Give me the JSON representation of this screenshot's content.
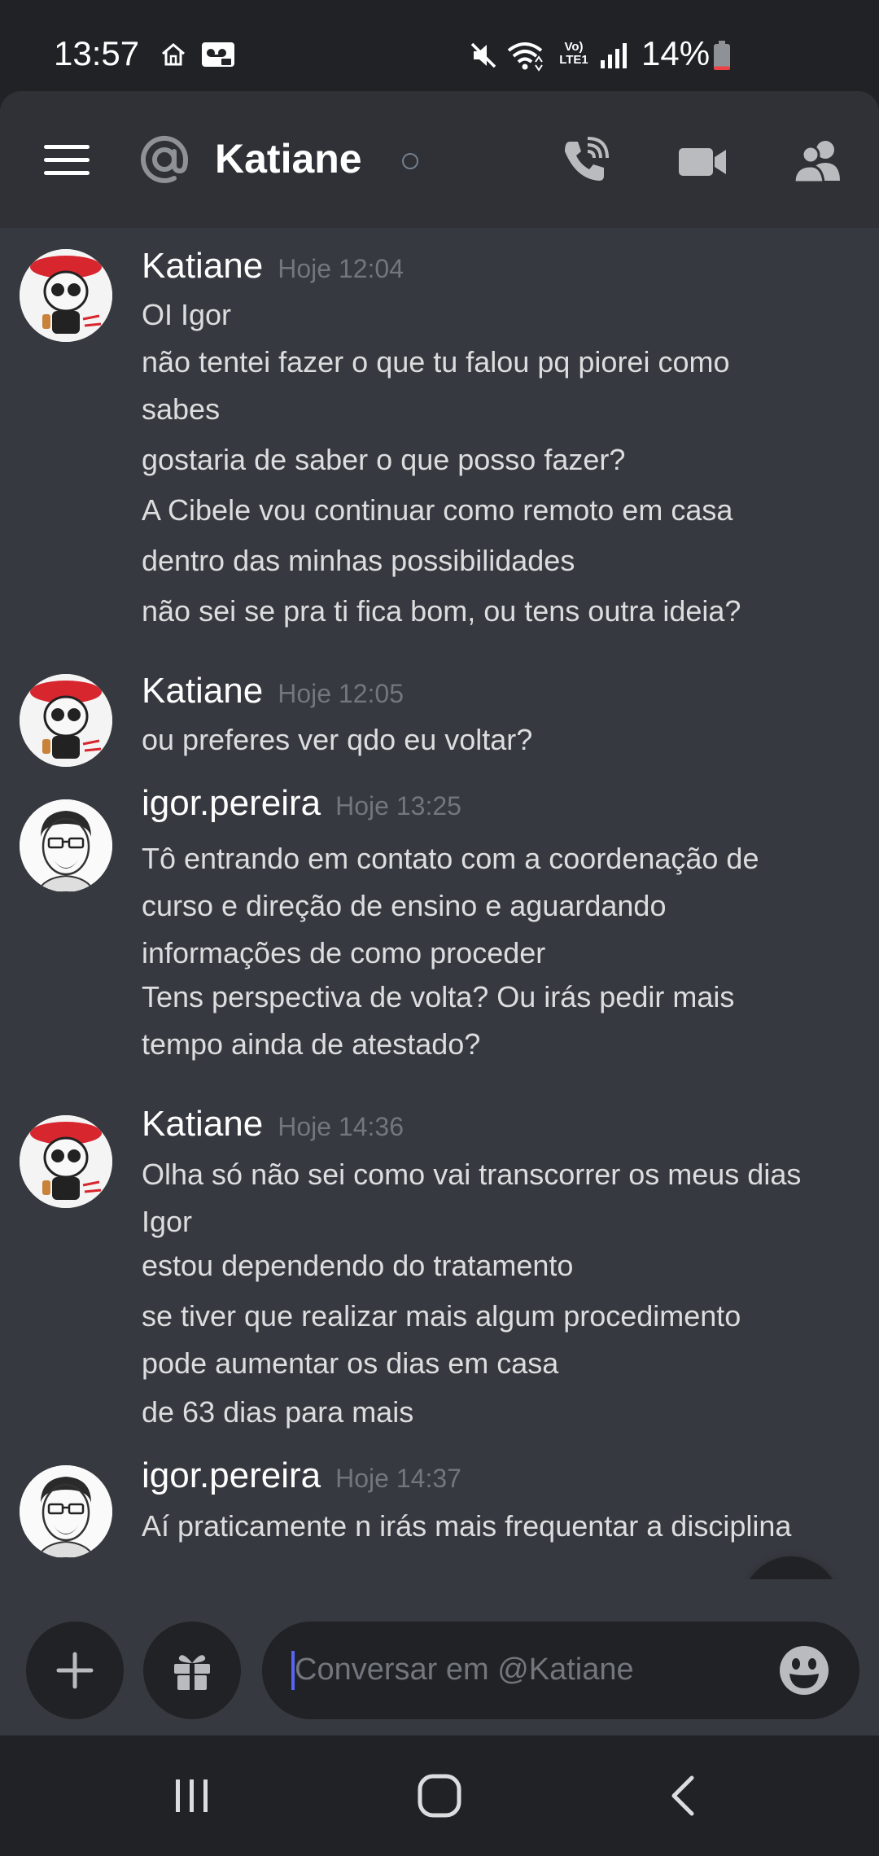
{
  "status_bar": {
    "time": "13:57",
    "battery_percent": "14%",
    "battery_level": 0.14,
    "network_label_top": "Vo)",
    "network_label_bottom": "LTE1"
  },
  "header": {
    "channel_name": "Katiane",
    "user_status": "offline"
  },
  "messages": [
    {
      "author": "Katiane",
      "timestamp": "Hoje 12:04",
      "avatar": "katiane-skull-avatar",
      "lines": [
        "OI Igor",
        "não tentei fazer o que tu falou pq piorei como",
        "sabes",
        "gostaria de saber o que posso fazer?",
        "A Cibele vou continuar como remoto em casa",
        "dentro das minhas possibilidades",
        "não sei se pra ti fica bom, ou tens outra ideia?"
      ]
    },
    {
      "author": "Katiane",
      "timestamp": "Hoje 12:05",
      "avatar": "katiane-skull-avatar",
      "lines": [
        "ou preferes ver qdo eu voltar?"
      ]
    },
    {
      "author": "igor.pereira",
      "timestamp": "Hoje 13:25",
      "avatar": "igor-sketch-avatar",
      "lines": [
        "Tô entrando em contato com a coordenação de",
        "curso e direção de ensino e aguardando",
        "informações de como proceder",
        "Tens perspectiva de volta? Ou irás pedir mais",
        "tempo ainda de atestado?"
      ]
    },
    {
      "author": "Katiane",
      "timestamp": "Hoje 14:36",
      "avatar": "katiane-skull-avatar",
      "lines": [
        "Olha só não sei como vai transcorrer os meus dias",
        "Igor",
        "estou dependendo do tratamento",
        "se tiver que realizar mais algum procedimento",
        "pode aumentar os dias em casa",
        "de 63 dias para mais"
      ]
    },
    {
      "author": "igor.pereira",
      "timestamp": "Hoje 14:37",
      "avatar": "igor-sketch-avatar",
      "lines": [
        "Aí praticamente n irás mais frequentar a disciplina"
      ]
    }
  ],
  "composer": {
    "placeholder": "Conversar em @Katiane"
  },
  "colors": {
    "background": "#36393f",
    "header": "#2f3136",
    "dark": "#202225",
    "text": "#dcddde",
    "muted": "#72767d",
    "accent": "#5865f2",
    "battery_low": "#ed4245"
  },
  "icons": {
    "menu": "hamburger-icon",
    "dm": "at-sign-icon",
    "call": "phone-call-icon",
    "video": "video-camera-icon",
    "members": "members-icon",
    "scroll": "chevron-down-icon",
    "add": "plus-icon",
    "gift": "gift-icon",
    "emoji": "emoji-icon"
  }
}
